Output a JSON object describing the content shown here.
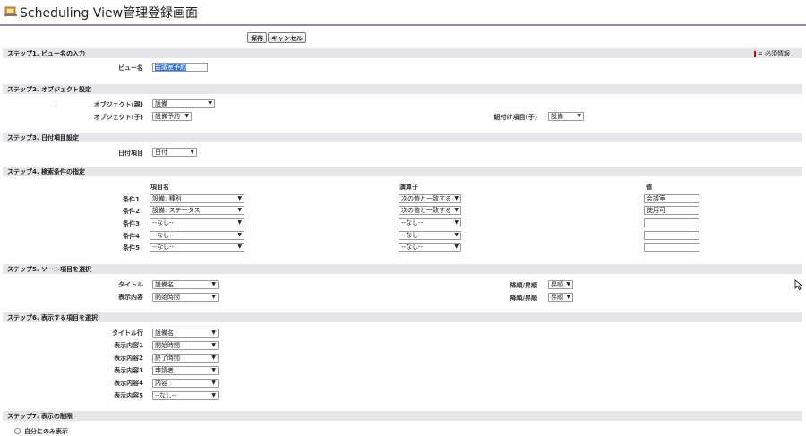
{
  "header": {
    "title": "Scheduling View管理登録画面"
  },
  "toolbar": {
    "save_label": "保存",
    "cancel_label": "キャンセル"
  },
  "required_note": "= 必須情報",
  "step1": {
    "title": "ステップ1. ビュー名の入力",
    "view_name_label": "ビュー名",
    "view_name_value": "会議室予約"
  },
  "step2": {
    "title": "ステップ2. オブジェクト設定",
    "parent_label": "オブジェクト(親)",
    "parent_value": "設備",
    "child_label": "オブジェクト(子)",
    "child_value": "設備予約",
    "link_label": "紐付け項目(子)",
    "link_value": "設備"
  },
  "step3": {
    "title": "ステップ3. 日付項目設定",
    "date_label": "日付項目",
    "date_value": "日付"
  },
  "step4": {
    "title": "ステップ4. 検索条件の指定",
    "col_field": "項目名",
    "col_operator": "演算子",
    "col_value": "値",
    "rows": [
      {
        "label": "条件1",
        "field": "設備: 種別",
        "operator": "次の値と一致する",
        "value": "会議室"
      },
      {
        "label": "条件2",
        "field": "設備: ステータス",
        "operator": "次の値と一致する",
        "value": "使用可"
      },
      {
        "label": "条件3",
        "field": "--なし--",
        "operator": "--なし--",
        "value": ""
      },
      {
        "label": "条件4",
        "field": "--なし--",
        "operator": "--なし--",
        "value": ""
      },
      {
        "label": "条件5",
        "field": "--なし--",
        "operator": "--なし--",
        "value": ""
      }
    ]
  },
  "step5": {
    "title": "ステップ5. ソート項目を選択",
    "rows": [
      {
        "label": "タイトル",
        "field": "設備名",
        "order_label": "降順/昇順",
        "order": "昇順"
      },
      {
        "label": "表示内容",
        "field": "開始時間",
        "order_label": "降順/昇順",
        "order": "昇順"
      }
    ]
  },
  "step6": {
    "title": "ステップ6. 表示する項目を選択",
    "rows": [
      {
        "label": "タイトル行",
        "value": "設備名"
      },
      {
        "label": "表示内容1",
        "value": "開始時間"
      },
      {
        "label": "表示内容2",
        "value": "終了時間"
      },
      {
        "label": "表示内容3",
        "value": "申請者"
      },
      {
        "label": "表示内容4",
        "value": "内容"
      },
      {
        "label": "表示内容5",
        "value": "--なし--"
      }
    ]
  },
  "step7": {
    "title": "ステップ7. 表示の制限",
    "option_own": "自分にのみ表示"
  },
  "colors": {
    "accent_rule": "#8a86c9",
    "section_bg": "#e5e6ea",
    "required": "#cc0000",
    "selection": "#3875d7"
  },
  "icons": {
    "app": "app-icon",
    "dropdown": "chevron-down-icon",
    "cursor": "mouse-cursor-icon"
  }
}
